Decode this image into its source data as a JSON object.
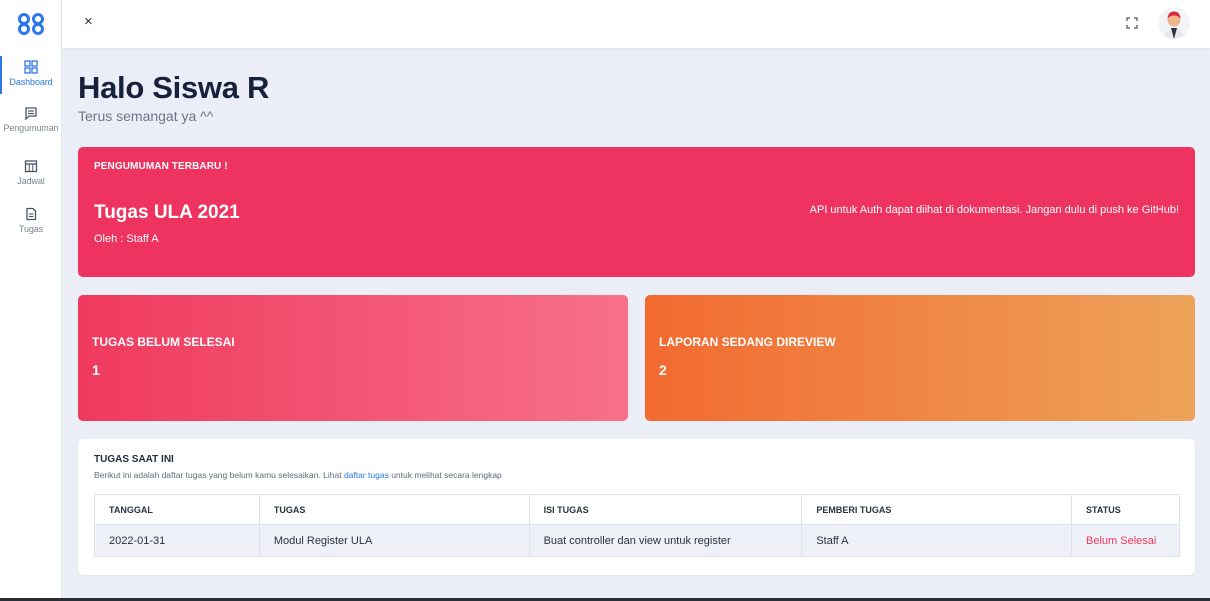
{
  "sidebar": {
    "items": [
      {
        "label": "Dashboard",
        "icon": "dashboard-icon"
      },
      {
        "label": "Pengumuman",
        "icon": "announcement-icon"
      },
      {
        "label": "Jadwal",
        "icon": "schedule-icon"
      },
      {
        "label": "Tugas",
        "icon": "task-icon"
      }
    ]
  },
  "topbar": {
    "close_symbol": "×"
  },
  "header": {
    "title": "Halo Siswa R",
    "subtitle": "Terus semangat ya ^^"
  },
  "announcement": {
    "heading": "PENGUMUMAN TERBARU !",
    "title": "Tugas ULA 2021",
    "author": "Oleh : Staff A",
    "description": "API untuk Auth dapat diihat di dokumentasi. Jangan dulu di push ke GitHub!"
  },
  "stats": [
    {
      "label": "TUGAS BELUM SELESAI",
      "value": "1"
    },
    {
      "label": "LAPORAN SEDANG DIREVIEW",
      "value": "2"
    }
  ],
  "tasks": {
    "title": "TUGAS SAAT INI",
    "desc_prefix": "Berikut ini adalah daftar tugas yang belum kamu selesaikan. Lihat ",
    "desc_link": "daftar tugas",
    "desc_suffix": " untuk melihat secara lengkap",
    "columns": [
      "TANGGAL",
      "TUGAS",
      "ISI TUGAS",
      "PEMBERI TUGAS",
      "STATUS"
    ],
    "rows": [
      [
        "2022-01-31",
        "Modul Register ULA",
        "Buat controller dan view untuk register",
        "Staff A",
        "Belum Selesai"
      ]
    ]
  },
  "colors": {
    "accent": "#2c78e6",
    "announcement_bg": "#ee3360",
    "stat1_start": "#ef3a5e",
    "stat1_end": "#f7708a",
    "stat2_start": "#f26a30",
    "stat2_end": "#eda35a",
    "status_red": "#ee3a5c"
  }
}
